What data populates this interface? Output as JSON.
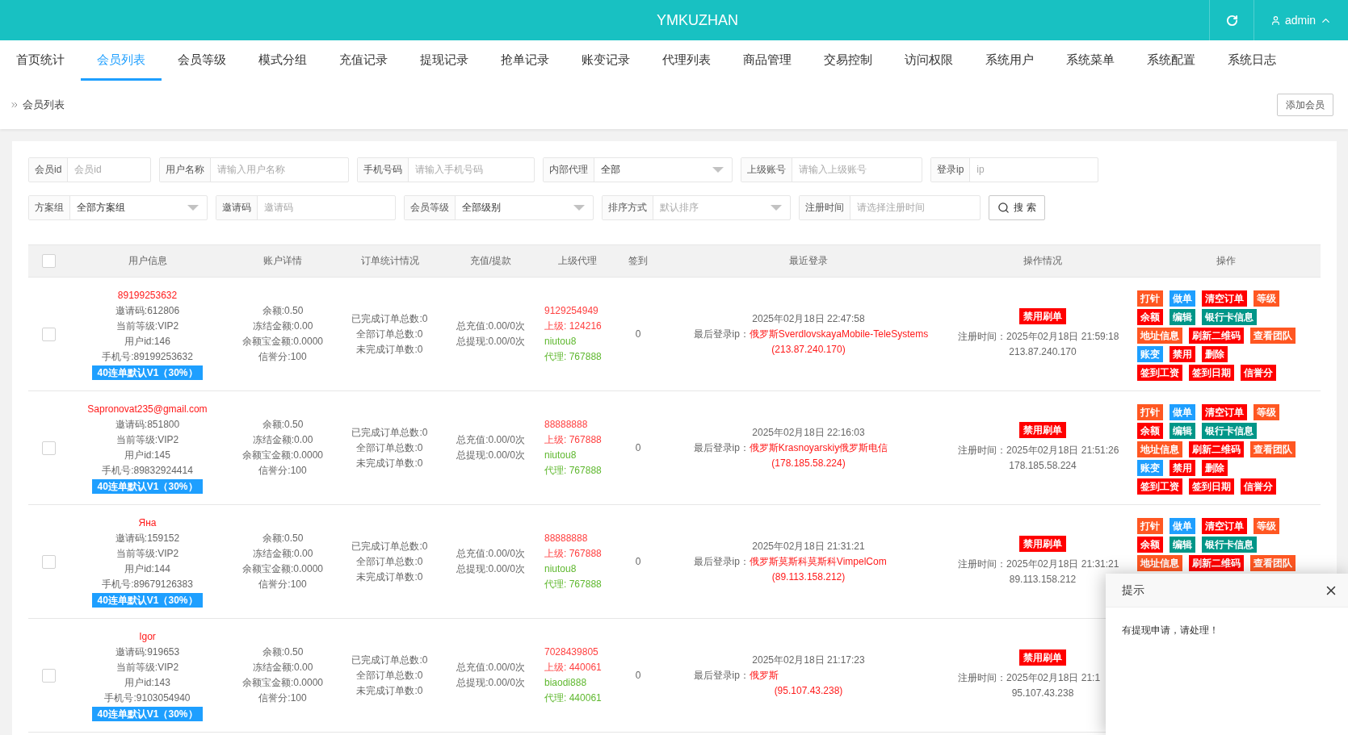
{
  "header": {
    "title": "YMKUZHAN",
    "user": "admin"
  },
  "nav": [
    {
      "label": "首页统计",
      "selected": false
    },
    {
      "label": "会员列表",
      "selected": true
    },
    {
      "label": "会员等级",
      "selected": false
    },
    {
      "label": "模式分组",
      "selected": false
    },
    {
      "label": "充值记录",
      "selected": false
    },
    {
      "label": "提现记录",
      "selected": false
    },
    {
      "label": "抢单记录",
      "selected": false
    },
    {
      "label": "账变记录",
      "selected": false
    },
    {
      "label": "代理列表",
      "selected": false
    },
    {
      "label": "商品管理",
      "selected": false
    },
    {
      "label": "交易控制",
      "selected": false
    },
    {
      "label": "访问权限",
      "selected": false
    },
    {
      "label": "系统用户",
      "selected": false
    },
    {
      "label": "系统菜单",
      "selected": false
    },
    {
      "label": "系统配置",
      "selected": false
    },
    {
      "label": "系统日志",
      "selected": false
    }
  ],
  "breadcrumb": "会员列表",
  "add_button": "添加会员",
  "filters": [
    [
      {
        "label": "会员id",
        "kind": "input",
        "placeholder": "会员id"
      },
      {
        "label": "用户名称",
        "kind": "input",
        "placeholder": "请输入用户名称"
      },
      {
        "label": "手机号码",
        "kind": "input",
        "placeholder": "请输入手机号码"
      },
      {
        "label": "内部代理",
        "kind": "select",
        "value": "全部"
      },
      {
        "label": "上级账号",
        "kind": "input",
        "placeholder": "请输入上级账号"
      },
      {
        "label": "登录ip",
        "kind": "input",
        "placeholder": "ip"
      }
    ],
    [
      {
        "label": "方案组",
        "kind": "select",
        "value": "全部方案组"
      },
      {
        "label": "邀请码",
        "kind": "input",
        "placeholder": "邀请码"
      },
      {
        "label": "会员等级",
        "kind": "select",
        "value": "全部级别"
      },
      {
        "label": "排序方式",
        "kind": "select",
        "placeholder": "默认排序"
      },
      {
        "label": "注册时间",
        "kind": "input",
        "placeholder": "请选择注册时间"
      }
    ]
  ],
  "search_button": "搜 索",
  "table": {
    "select_all": {
      "checked": false
    },
    "columns": [
      "用户信息",
      "账户详情",
      "订单统计情况",
      "充值/提款",
      "上级代理",
      "签到",
      "最近登录",
      "操作情况",
      "操作"
    ],
    "rows": [
      {
        "checked": false,
        "name": "89199253632",
        "user_lines": [
          "邀请码:612806",
          "当前等级:VIP2",
          "用户id:146",
          "手机号:89199253632"
        ],
        "plan": "40连单默认V1（30%）",
        "account": [
          "余额:0.50",
          "冻结金额:0.00",
          "余额宝金额:0.0000",
          "信誉分:100"
        ],
        "orders": [
          "已完成订单总数:0",
          "全部订单总数:0",
          "未完成订单数:0"
        ],
        "funds": [
          "总充值:0.00/0次",
          "总提现:0.00/0次"
        ],
        "superior": {
          "code": "9129254949",
          "label": "上级:",
          "id": "124216"
        },
        "agent": {
          "name": "niutou8",
          "label": "代理:",
          "id": "767888"
        },
        "checkin": "0",
        "login_time": "2025年02月18日 22:47:58",
        "login_label": "最后登录ip：",
        "login_location": "俄罗斯SverdlovskayaMobile-TeleSystems",
        "login_ip": "(213.87.240.170)",
        "status_badge": "禁用刷单",
        "reg_label": "注册时间：",
        "reg_time": "2025年02月18日 21:59:18",
        "reg_ip": "213.87.240.170",
        "actions": [
          [
            {
              "label": "打针",
              "kind": "warm"
            },
            {
              "label": "做单",
              "kind": "normal"
            },
            {
              "label": "清空订单",
              "kind": "danger"
            },
            {
              "label": "等级",
              "kind": "warm"
            }
          ],
          [
            {
              "label": "余额",
              "kind": "danger"
            },
            {
              "label": "编辑",
              "kind": "success"
            },
            {
              "label": "银行卡信息",
              "kind": "success"
            }
          ],
          [
            {
              "label": "地址信息",
              "kind": "warm"
            },
            {
              "label": "刷新二维码",
              "kind": "danger"
            },
            {
              "label": "查看团队",
              "kind": "warm"
            }
          ],
          [
            {
              "label": "账变",
              "kind": "normal"
            },
            {
              "label": "禁用",
              "kind": "danger"
            },
            {
              "label": "删除",
              "kind": "danger"
            }
          ],
          [
            {
              "label": "签到工资",
              "kind": "danger"
            },
            {
              "label": "签到日期",
              "kind": "danger"
            },
            {
              "label": "信誉分",
              "kind": "danger"
            }
          ]
        ]
      },
      {
        "checked": false,
        "name": "Sapronovat235@gmail.com",
        "user_lines": [
          "邀请码:851800",
          "当前等级:VIP2",
          "用户id:145",
          "手机号:89832924414"
        ],
        "plan": "40连单默认V1（30%）",
        "account": [
          "余额:0.50",
          "冻结金额:0.00",
          "余额宝金额:0.0000",
          "信誉分:100"
        ],
        "orders": [
          "已完成订单总数:0",
          "全部订单总数:0",
          "未完成订单数:0"
        ],
        "funds": [
          "总充值:0.00/0次",
          "总提现:0.00/0次"
        ],
        "superior": {
          "code": "88888888",
          "label": "上级:",
          "id": "767888"
        },
        "agent": {
          "name": "niutou8",
          "label": "代理:",
          "id": "767888"
        },
        "checkin": "0",
        "login_time": "2025年02月18日 22:16:03",
        "login_label": "最后登录ip：",
        "login_location": "俄罗斯Krasnoyarskiy俄罗斯电信",
        "login_ip": "(178.185.58.224)",
        "status_badge": "禁用刷单",
        "reg_label": "注册时间：",
        "reg_time": "2025年02月18日 21:51:26",
        "reg_ip": "178.185.58.224",
        "actions": [
          [
            {
              "label": "打针",
              "kind": "warm"
            },
            {
              "label": "做单",
              "kind": "normal"
            },
            {
              "label": "清空订单",
              "kind": "danger"
            },
            {
              "label": "等级",
              "kind": "warm"
            }
          ],
          [
            {
              "label": "余额",
              "kind": "danger"
            },
            {
              "label": "编辑",
              "kind": "success"
            },
            {
              "label": "银行卡信息",
              "kind": "success"
            }
          ],
          [
            {
              "label": "地址信息",
              "kind": "warm"
            },
            {
              "label": "刷新二维码",
              "kind": "danger"
            },
            {
              "label": "查看团队",
              "kind": "warm"
            }
          ],
          [
            {
              "label": "账变",
              "kind": "normal"
            },
            {
              "label": "禁用",
              "kind": "danger"
            },
            {
              "label": "删除",
              "kind": "danger"
            }
          ],
          [
            {
              "label": "签到工资",
              "kind": "danger"
            },
            {
              "label": "签到日期",
              "kind": "danger"
            },
            {
              "label": "信誉分",
              "kind": "danger"
            }
          ]
        ]
      },
      {
        "checked": false,
        "name": "Яна",
        "user_lines": [
          "邀请码:159152",
          "当前等级:VIP2",
          "用户id:144",
          "手机号:89679126383"
        ],
        "plan": "40连单默认V1（30%）",
        "account": [
          "余额:0.50",
          "冻结金额:0.00",
          "余额宝金额:0.0000",
          "信誉分:100"
        ],
        "orders": [
          "已完成订单总数:0",
          "全部订单总数:0",
          "未完成订单数:0"
        ],
        "funds": [
          "总充值:0.00/0次",
          "总提现:0.00/0次"
        ],
        "superior": {
          "code": "88888888",
          "label": "上级:",
          "id": "767888"
        },
        "agent": {
          "name": "niutou8",
          "label": "代理:",
          "id": "767888"
        },
        "checkin": "0",
        "login_time": "2025年02月18日 21:31:21",
        "login_label": "最后登录ip：",
        "login_location": "俄罗斯莫斯科莫斯科VimpelCom",
        "login_ip": "(89.113.158.212)",
        "status_badge": "禁用刷单",
        "reg_label": "注册时间：",
        "reg_time": "2025年02月18日 21:31:21",
        "reg_ip": "89.113.158.212",
        "actions": [
          [
            {
              "label": "打针",
              "kind": "warm"
            },
            {
              "label": "做单",
              "kind": "normal"
            },
            {
              "label": "清空订单",
              "kind": "danger"
            },
            {
              "label": "等级",
              "kind": "warm"
            }
          ],
          [
            {
              "label": "余额",
              "kind": "danger"
            },
            {
              "label": "编辑",
              "kind": "success"
            },
            {
              "label": "银行卡信息",
              "kind": "success"
            }
          ],
          [
            {
              "label": "地址信息",
              "kind": "warm"
            },
            {
              "label": "刷新二维码",
              "kind": "danger"
            },
            {
              "label": "查看团队",
              "kind": "warm"
            }
          ]
        ]
      },
      {
        "checked": false,
        "name": "Igor",
        "user_lines": [
          "邀请码:919653",
          "当前等级:VIP2",
          "用户id:143",
          "手机号:9103054940"
        ],
        "plan": "40连单默认V1（30%）",
        "account": [
          "余额:0.50",
          "冻结金额:0.00",
          "余额宝金额:0.0000",
          "信誉分:100"
        ],
        "orders": [
          "已完成订单总数:0",
          "全部订单总数:0",
          "未完成订单数:0"
        ],
        "funds": [
          "总充值:0.00/0次",
          "总提现:0.00/0次"
        ],
        "superior": {
          "code": "7028439805",
          "label": "上级:",
          "id": "440061"
        },
        "agent": {
          "name": "biaodi888",
          "label": "代理:",
          "id": "440061"
        },
        "checkin": "0",
        "login_time": "2025年02月18日 21:17:23",
        "login_label": "最后登录ip：",
        "login_location": "俄罗斯",
        "login_ip": "(95.107.43.238)",
        "status_badge": "禁用刷单",
        "reg_label": "注册时间：",
        "reg_time": "2025年02月18日 21:1",
        "reg_ip": "95.107.43.238"
      }
    ]
  },
  "popup": {
    "title": "提示",
    "message": "有提现申请，请处理！"
  }
}
